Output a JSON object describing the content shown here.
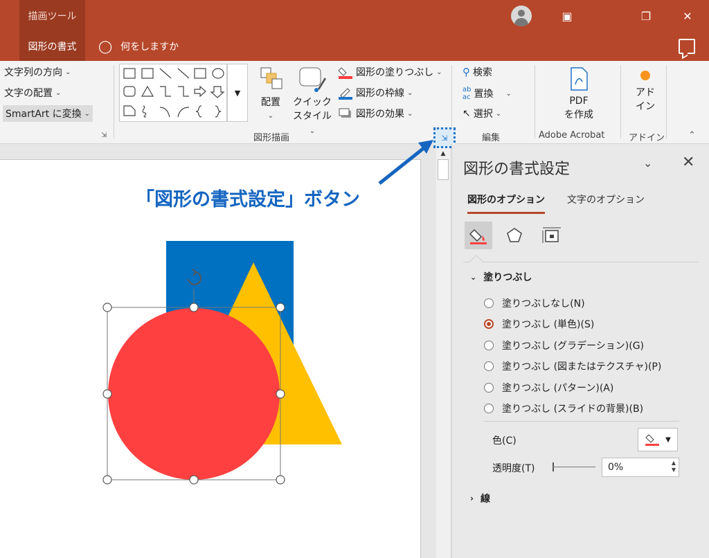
{
  "titlebar": {
    "context_tab": "描画ツール"
  },
  "tabs": {
    "active": "図形の書式",
    "tellme": "何をしますか"
  },
  "ribbon": {
    "text_direction": "文字列の方向",
    "text_align": "文字の配置",
    "smartart": "SmartArt に変換",
    "arrange": "配置",
    "quick_style_1": "クイック",
    "quick_style_2": "スタイル",
    "shape_fill": "図形の塗りつぶし",
    "shape_outline": "図形の枠線",
    "shape_effects": "図形の効果",
    "group_drawing": "図形描画",
    "find": "検索",
    "replace": "置換",
    "select": "選択",
    "group_edit": "編集",
    "pdf_1": "PDF",
    "pdf_2": "を作成",
    "group_acrobat": "Adobe Acrobat",
    "addin_1": "アド",
    "addin_2": "イン",
    "group_addin": "アドイン"
  },
  "callout": "「図形の書式設定」ボタン",
  "pane": {
    "title": "図形の書式設定",
    "tab_shape": "図形のオプション",
    "tab_text": "文字のオプション",
    "section_fill": "塗りつぶし",
    "fill_options": [
      "塗りつぶしなし(N)",
      "塗りつぶし (単色)(S)",
      "塗りつぶし (グラデーション)(G)",
      "塗りつぶし (図またはテクスチャ)(P)",
      "塗りつぶし (パターン)(A)",
      "塗りつぶし (スライドの背景)(B)"
    ],
    "color_label": "色(C)",
    "transparency_label": "透明度(T)",
    "transparency_value": "0%",
    "section_line": "線"
  },
  "colors": {
    "accent": "#b7472a",
    "rect": "#0070c0",
    "triangle": "#ffc000",
    "circle": "#ff4040",
    "callout": "#1565c0"
  }
}
